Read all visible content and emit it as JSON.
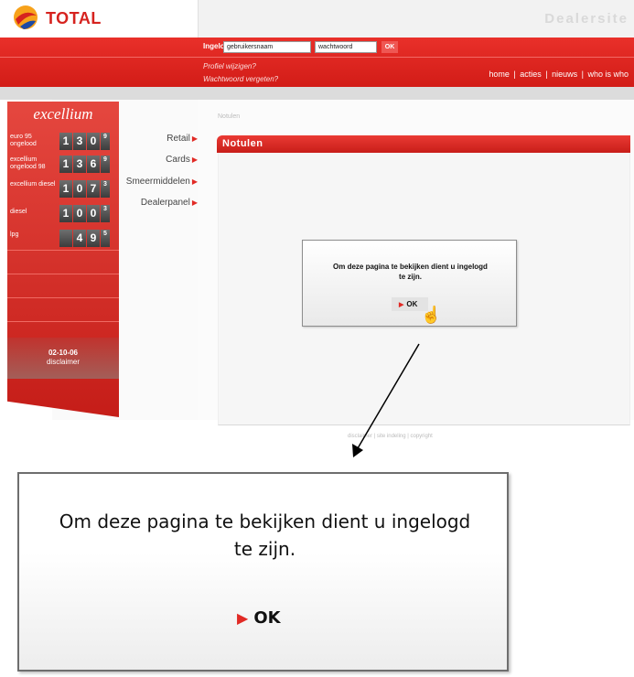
{
  "header": {
    "logo_text": "TOTAL",
    "site_name": "Dealersite"
  },
  "login": {
    "label": "Ingelogd als",
    "username_value": "gebruikersnaam",
    "password_value": "wachtwoord",
    "ok_label": "OK",
    "link_profile": "Profiel wijzigen?",
    "link_forgot": "Wachtwoord vergeten?"
  },
  "topnav": [
    "home",
    "acties",
    "nieuws",
    "who is who"
  ],
  "pump": {
    "brand": "excellium",
    "rows": [
      {
        "label": "euro 95 ongelood",
        "digits": [
          "1",
          "3",
          "0"
        ],
        "sup": "9"
      },
      {
        "label": "excellium ongelood 98",
        "digits": [
          "1",
          "3",
          "6"
        ],
        "sup": "9"
      },
      {
        "label": "excellium diesel",
        "digits": [
          "1",
          "0",
          "7"
        ],
        "sup": "3"
      },
      {
        "label": "diesel",
        "digits": [
          "1",
          "0",
          "0"
        ],
        "sup": "3"
      },
      {
        "label": "lpg",
        "digits": [
          "",
          "4",
          "9"
        ],
        "sup": "5"
      }
    ],
    "date": "02-10-06",
    "disclaimer": "disclaimer"
  },
  "menu": [
    "Retail",
    "Cards",
    "Smeermiddelen",
    "Dealerpanel"
  ],
  "breadcrumb": "Notulen",
  "panel_title": "Notulen",
  "dialog": {
    "line1": "Om deze pagina te bekijken dient u ingelogd",
    "line2": "te zijn.",
    "ok_label": "OK"
  },
  "footer": "disclaimer | site indeling | copyright",
  "colors": {
    "accent": "#d6231f",
    "red_band": "#e2261f"
  }
}
